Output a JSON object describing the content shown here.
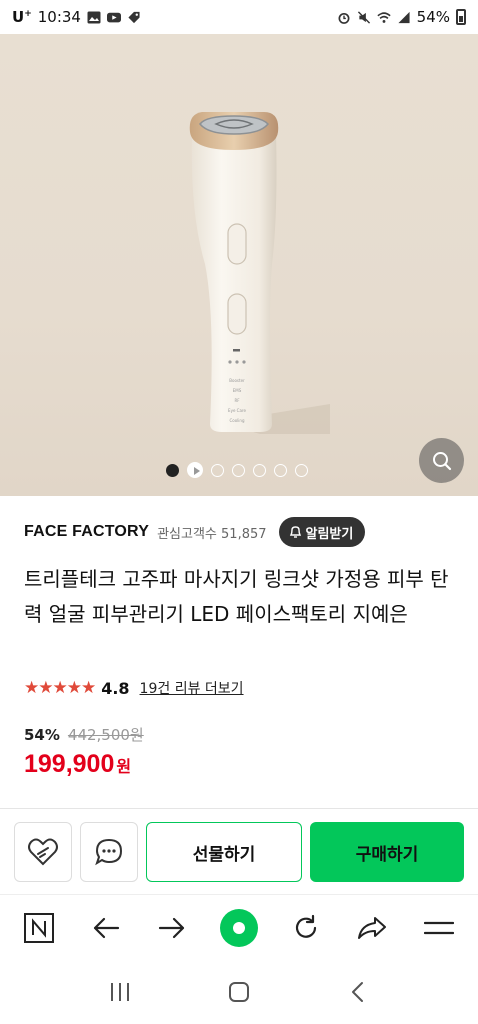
{
  "status_bar": {
    "carrier": "U",
    "carrier_sup": "+",
    "time": "10:34",
    "battery": "54%"
  },
  "store": {
    "name": "FACE FACTORY",
    "fans_label": "관심고객수 51,857",
    "alarm_label": "알림받기"
  },
  "product": {
    "title": "트리플테크 고주파 마사지기 링크샷 가정용 피부 탄력 얼굴 피부관리기 LED 페이스팩토리 지예은",
    "stars": "★★★★★",
    "rating": "4.8",
    "review_link": "19건 리뷰 더보기",
    "discount": "54%",
    "original_price": "442,500원",
    "price": "199,900",
    "currency": "원"
  },
  "actions": {
    "gift_label": "선물하기",
    "buy_label": "구매하기"
  },
  "device_labels": [
    "Booster",
    "EMS",
    "RF",
    "Eye Care",
    "Cooling"
  ],
  "colors": {
    "naver_green": "#03c75a",
    "price_red": "#e3001b",
    "star_red": "#e04a3a"
  }
}
